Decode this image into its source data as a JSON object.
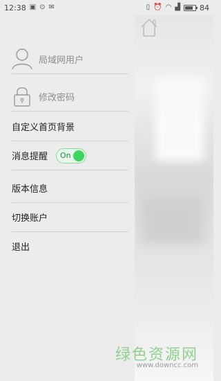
{
  "status_bar": {
    "time": "12:38",
    "battery": "84",
    "battery_level": 0.84,
    "left_icons": [
      "image-icon",
      "check-circle-icon",
      "mail-icon"
    ],
    "right_icons": [
      "vibrate-icon",
      "alarm-icon",
      "wifi-icon",
      "signal-icon",
      "battery-icon"
    ]
  },
  "drawer": {
    "user": {
      "label": "局域网用户",
      "icon": "user-icon"
    },
    "password": {
      "label": "修改密码",
      "icon": "lock-icon"
    },
    "items": [
      {
        "label": "自定义首页背景"
      },
      {
        "label": "消息提醒",
        "toggle": "On"
      },
      {
        "label": "版本信息"
      },
      {
        "label": "切换账户"
      },
      {
        "label": "退出"
      }
    ]
  },
  "watermark": {
    "cn": "绿色资源网",
    "en": "www.downcc.com"
  },
  "colors": {
    "toggle_on": "#3fd45d",
    "watermark_green": "#8fd08f"
  }
}
